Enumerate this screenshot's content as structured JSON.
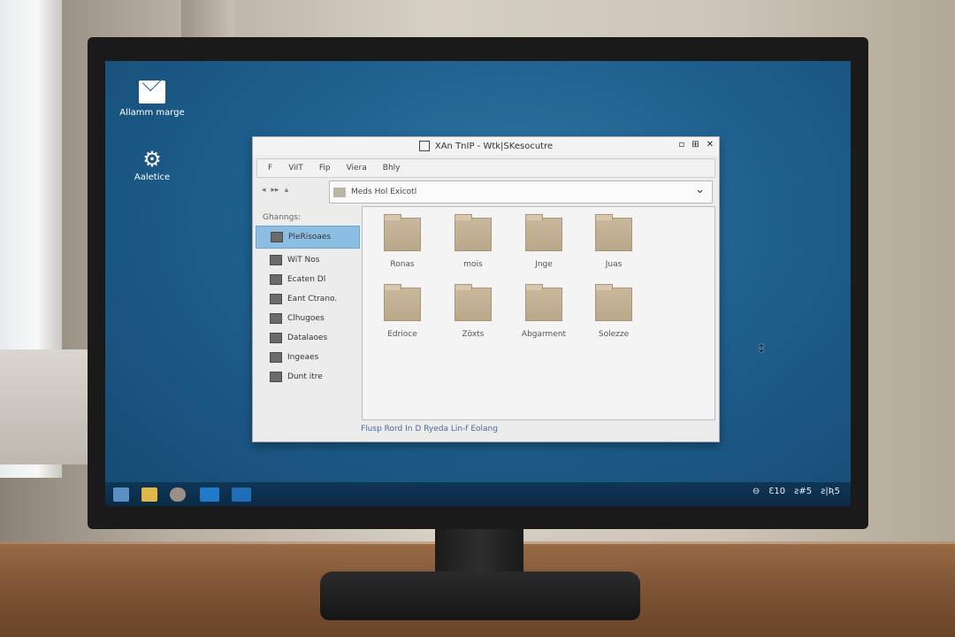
{
  "desktop": {
    "icons": [
      {
        "label": "Allamm marge",
        "icon": "mail-icon"
      },
      {
        "label": "Aaletice",
        "icon": "gear-icon"
      }
    ]
  },
  "window": {
    "title": "XAn TnIP - Wtk|SKesocutre",
    "controls": [
      "▫",
      "⊞",
      "✕"
    ]
  },
  "menu": [
    "F",
    "ViIT",
    "Fip",
    "Viera",
    "Bhly"
  ],
  "toolbar": {
    "back": "◂",
    "forward": "▸▸",
    "up": "▴"
  },
  "address": {
    "value": "Meds  Hol Exicotl"
  },
  "sidebar": {
    "heading": "Ghanngs:",
    "items": [
      {
        "label": "PleRisoaes",
        "selected": true
      },
      {
        "label": "WiT Nos"
      },
      {
        "label": "Ecaten Dl"
      },
      {
        "label": "Eant Ctrano."
      },
      {
        "label": "Clhugoes"
      },
      {
        "label": "Datalaoes"
      },
      {
        "label": "Ingeaes"
      },
      {
        "label": "Dunt itre"
      }
    ]
  },
  "folders": [
    "Ronas",
    "mois",
    "Jnge",
    "Juas",
    "Edrioce",
    "Zöxts",
    "Abgarment",
    "Solezze"
  ],
  "status": "Flusp Rord In   D Ryeda Lin-f Eolang",
  "taskbar": {
    "apps": [
      "files-app-icon",
      "bag-app-icon",
      "user-app-icon",
      "chat-app-icon",
      "sync-app-icon"
    ],
    "tray": [
      "⊖",
      "Ɛ10",
      "ƨ#5",
      "ƨ|Ʀ5"
    ]
  },
  "colors": {
    "desktop": "#1f5f8e",
    "selection": "#8cbde3",
    "taskbar": "#0f3656"
  }
}
